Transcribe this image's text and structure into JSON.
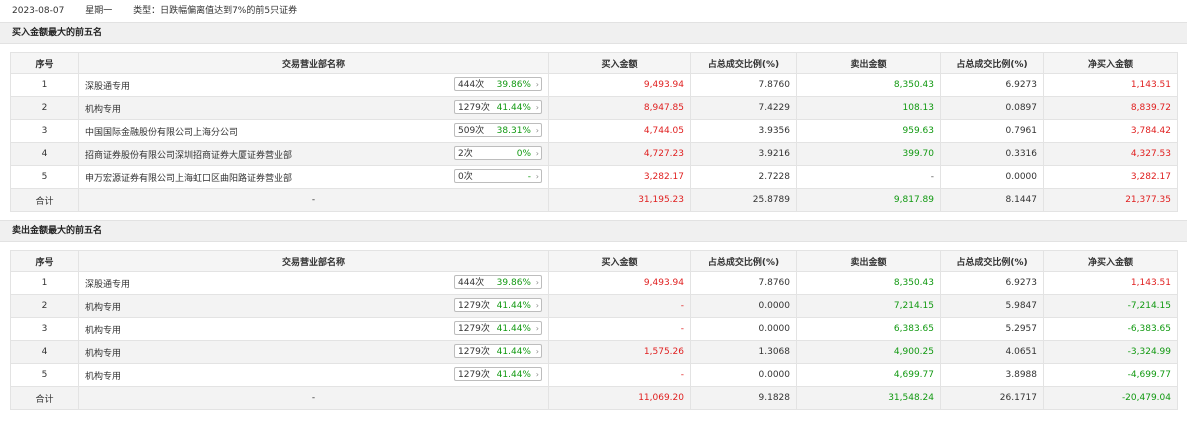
{
  "header": {
    "date": "2023-08-07",
    "weekday": "星期一",
    "type_label": "类型：日跌幅偏离值达到7%的前5只证券"
  },
  "columns": [
    "序号",
    "交易营业部名称",
    "买入金额",
    "占总成交比例(%)",
    "卖出金额",
    "占总成交比例(%)",
    "净买入金额"
  ],
  "buy_section": {
    "title": "买入金额最大的前五名",
    "rows": [
      {
        "no": "1",
        "name": "深股通专用",
        "count": "444次",
        "pct": "39.86%",
        "arrow": "›",
        "buy": "9,493.94",
        "buy_pct": "7.8760",
        "sell": "8,350.43",
        "sell_pct": "6.9273",
        "net": "1,143.51"
      },
      {
        "no": "2",
        "name": "机构专用",
        "count": "1279次",
        "pct": "41.44%",
        "arrow": "›",
        "buy": "8,947.85",
        "buy_pct": "7.4229",
        "sell": "108.13",
        "sell_pct": "0.0897",
        "net": "8,839.72"
      },
      {
        "no": "3",
        "name": "中国国际金融股份有限公司上海分公司",
        "count": "509次",
        "pct": "38.31%",
        "arrow": "›",
        "buy": "4,744.05",
        "buy_pct": "3.9356",
        "sell": "959.63",
        "sell_pct": "0.7961",
        "net": "3,784.42"
      },
      {
        "no": "4",
        "name": "招商证券股份有限公司深圳招商证券大厦证券营业部",
        "count": "2次",
        "pct": "0%",
        "arrow": "›",
        "buy": "4,727.23",
        "buy_pct": "3.9216",
        "sell": "399.70",
        "sell_pct": "0.3316",
        "net": "4,327.53"
      },
      {
        "no": "5",
        "name": "申万宏源证券有限公司上海虹口区曲阳路证券营业部",
        "count": "0次",
        "pct": "-",
        "arrow": "›",
        "buy": "3,282.17",
        "buy_pct": "2.7228",
        "sell": "-",
        "sell_pct": "0.0000",
        "net": "3,282.17"
      }
    ],
    "total": {
      "label": "合计",
      "name": "-",
      "buy": "31,195.23",
      "buy_pct": "25.8789",
      "sell": "9,817.89",
      "sell_pct": "8.1447",
      "net": "21,377.35"
    }
  },
  "sell_section": {
    "title": "卖出金额最大的前五名",
    "rows": [
      {
        "no": "1",
        "name": "深股通专用",
        "count": "444次",
        "pct": "39.86%",
        "arrow": "›",
        "buy": "9,493.94",
        "buy_pct": "7.8760",
        "sell": "8,350.43",
        "sell_pct": "6.9273",
        "net": "1,143.51"
      },
      {
        "no": "2",
        "name": "机构专用",
        "count": "1279次",
        "pct": "41.44%",
        "arrow": "›",
        "buy": "-",
        "buy_pct": "0.0000",
        "sell": "7,214.15",
        "sell_pct": "5.9847",
        "net": "-7,214.15"
      },
      {
        "no": "3",
        "name": "机构专用",
        "count": "1279次",
        "pct": "41.44%",
        "arrow": "›",
        "buy": "-",
        "buy_pct": "0.0000",
        "sell": "6,383.65",
        "sell_pct": "5.2957",
        "net": "-6,383.65"
      },
      {
        "no": "4",
        "name": "机构专用",
        "count": "1279次",
        "pct": "41.44%",
        "arrow": "›",
        "buy": "1,575.26",
        "buy_pct": "1.3068",
        "sell": "4,900.25",
        "sell_pct": "4.0651",
        "net": "-3,324.99"
      },
      {
        "no": "5",
        "name": "机构专用",
        "count": "1279次",
        "pct": "41.44%",
        "arrow": "›",
        "buy": "-",
        "buy_pct": "0.0000",
        "sell": "4,699.77",
        "sell_pct": "3.8988",
        "net": "-4,699.77"
      }
    ],
    "total": {
      "label": "合计",
      "name": "-",
      "buy": "11,069.20",
      "buy_pct": "9.1828",
      "sell": "31,548.24",
      "sell_pct": "26.1717",
      "net": "-20,479.04"
    }
  },
  "colors": {
    "positive": "#e02020",
    "negative": "#119911",
    "header_bg": "#f0f0f0"
  }
}
